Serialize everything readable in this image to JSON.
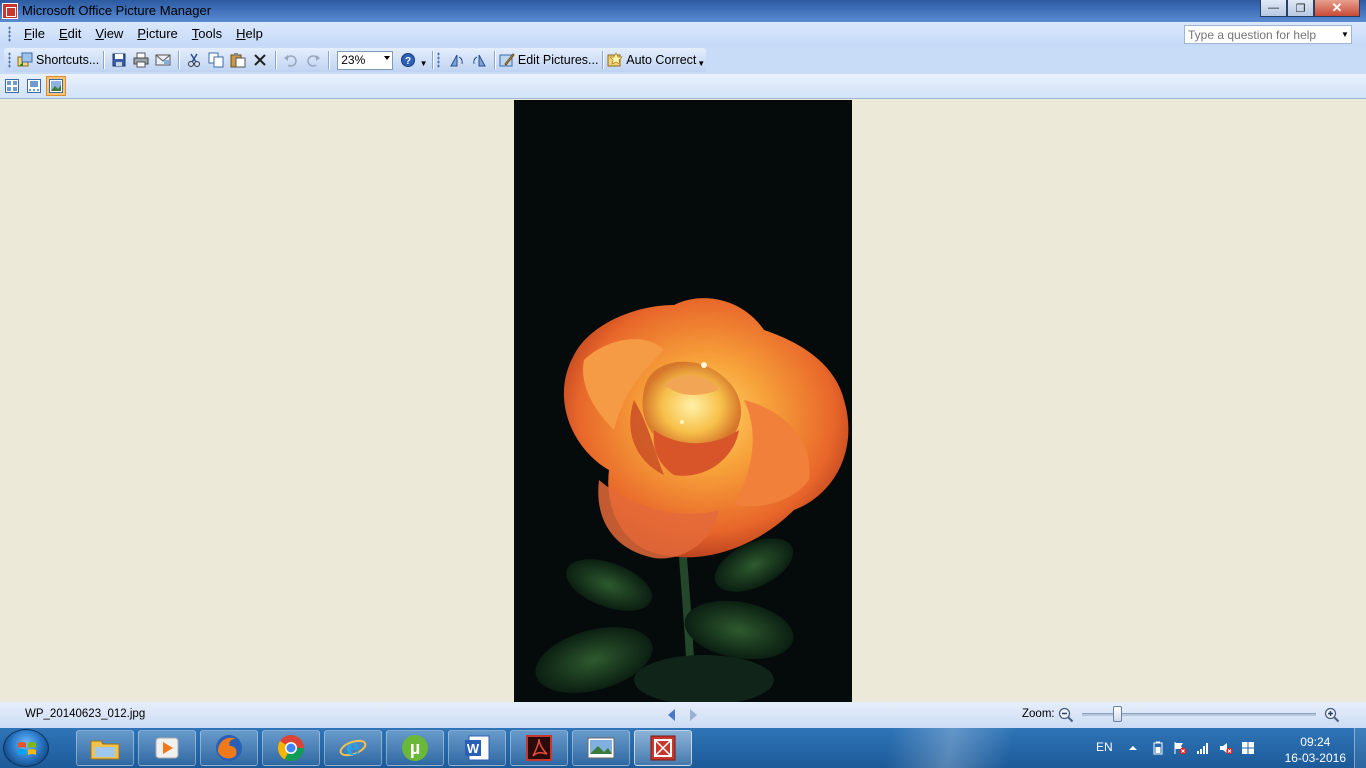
{
  "window": {
    "title": "Microsoft Office Picture Manager"
  },
  "menu": {
    "items": [
      {
        "label": "File",
        "accel": "F"
      },
      {
        "label": "Edit",
        "accel": "E"
      },
      {
        "label": "View",
        "accel": "V"
      },
      {
        "label": "Picture",
        "accel": "P"
      },
      {
        "label": "Tools",
        "accel": "T"
      },
      {
        "label": "Help",
        "accel": "H"
      }
    ],
    "help_placeholder": "Type a question for help"
  },
  "toolbar": {
    "shortcuts_label": "Shortcuts...",
    "zoom_value": "23%",
    "edit_pictures_label": "Edit Pictures...",
    "auto_correct_label": "Auto Correct"
  },
  "status": {
    "filename": "WP_20140623_012.jpg",
    "zoom_label": "Zoom:",
    "zoom_slider_fraction": 0.15
  },
  "taskbar": {
    "apps": [
      "explorer",
      "media-player",
      "firefox",
      "chrome",
      "internet-explorer",
      "utorrent",
      "word",
      "acrobat",
      "photo-viewer",
      "picture-manager"
    ],
    "language": "EN",
    "time": "09:24",
    "date": "16-03-2016"
  },
  "colors": {
    "accent": "#c8372d",
    "workspace": "#ece9d8",
    "taskbar": "#1c5a98"
  }
}
